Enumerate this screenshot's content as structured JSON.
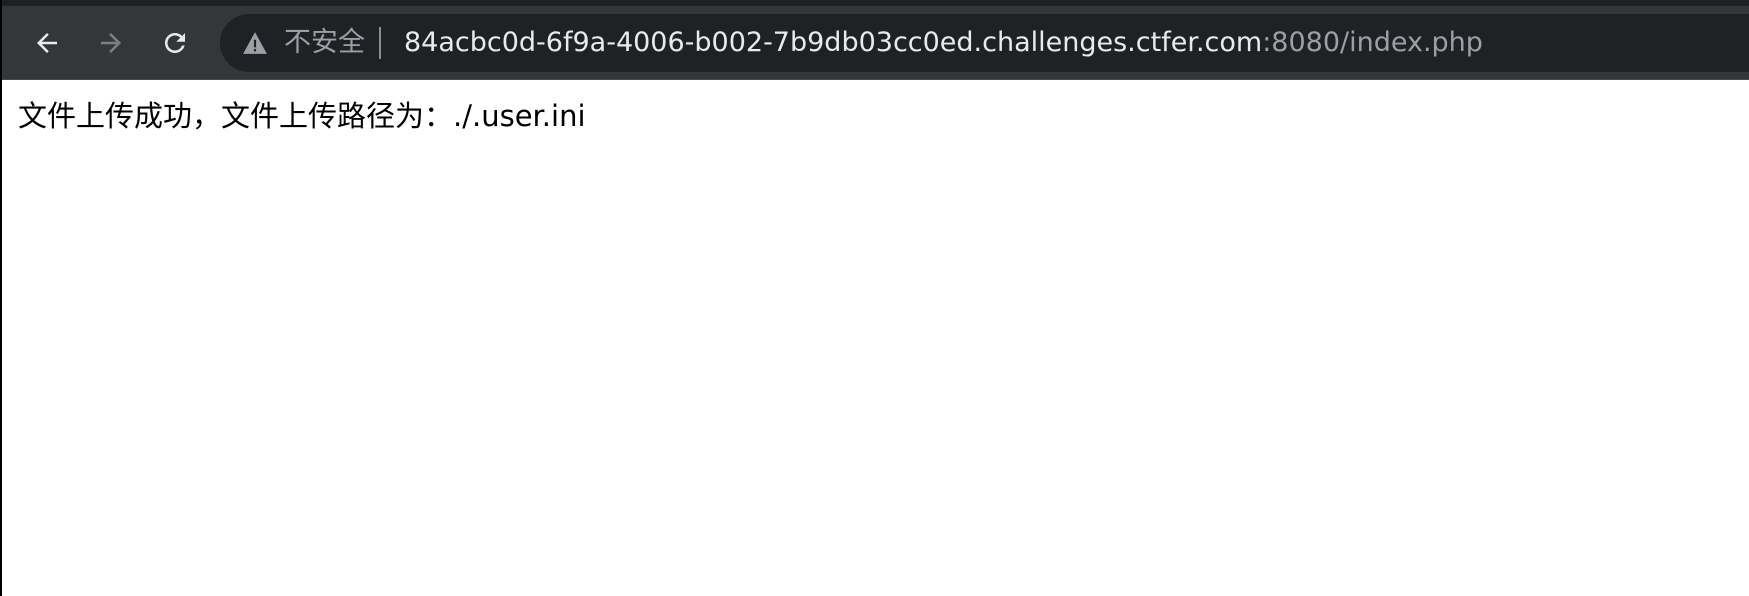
{
  "toolbar": {
    "back_icon": "arrow-left-icon",
    "forward_icon": "arrow-right-icon",
    "reload_icon": "reload-icon"
  },
  "omnibox": {
    "security_icon": "warning-triangle-icon",
    "security_label": "不安全",
    "url_host": "84acbc0d-6f9a-4006-b002-7b9db03cc0ed.challenges.ctfer.com",
    "url_rest": ":8080/index.php"
  },
  "page": {
    "message": "文件上传成功，文件上传路径为：./.user.ini"
  },
  "colors": {
    "toolbar_bg": "#35363a",
    "omnibox_bg": "#202124",
    "url_host": "#e8eaed",
    "url_dim": "#9aa0a6"
  }
}
